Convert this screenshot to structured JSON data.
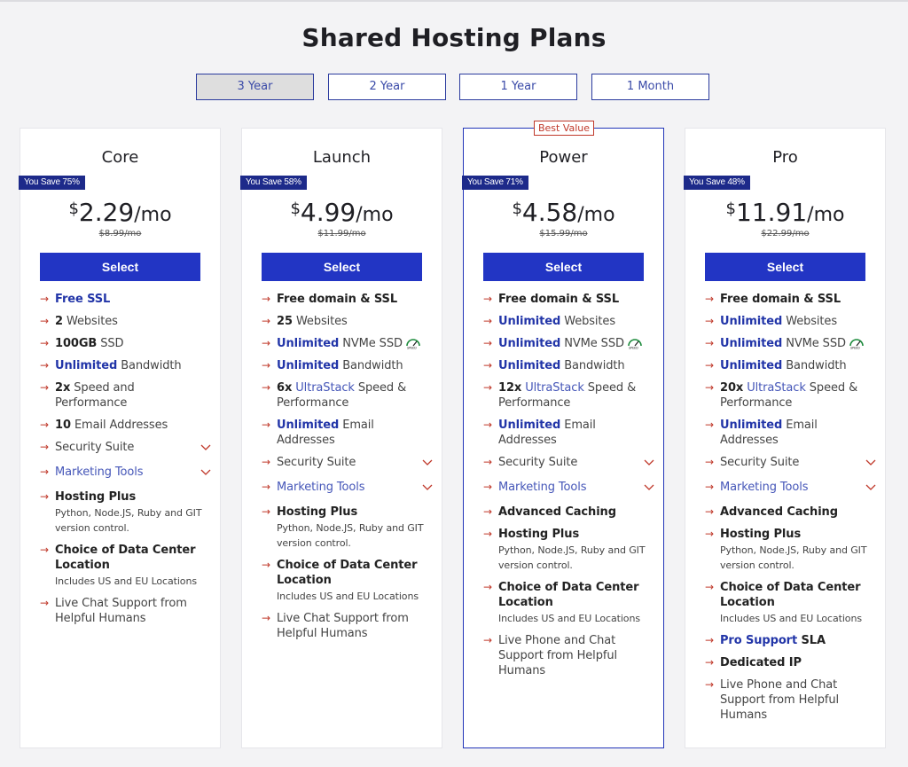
{
  "page_title": "Shared Hosting Plans",
  "terms": [
    "3 Year",
    "2 Year",
    "1 Year",
    "1 Month"
  ],
  "best_value_label": "Best Value",
  "plans": [
    {
      "name": "Core",
      "save": "You Save 75%",
      "currency": "$",
      "amount": "2.29",
      "per": "/mo",
      "old": "$8.99/mo",
      "button": "Select",
      "features": [
        {
          "hl": "Free SSL",
          "text": ""
        },
        {
          "bold": "2",
          "text": " Websites"
        },
        {
          "bold": "100GB",
          "text": " SSD"
        },
        {
          "hl": "Unlimited",
          "text": " Bandwidth"
        },
        {
          "bold": "2x",
          "text": " Speed and Performance"
        },
        {
          "bold": "10",
          "text": " Email Addresses"
        },
        {
          "text": "Security Suite",
          "expand": true
        },
        {
          "link": "Marketing Tools",
          "expand": true
        },
        {
          "bold": "Hosting Plus",
          "sub": "Python, Node.JS, Ruby and GIT version control."
        },
        {
          "bold": "Choice of Data Center Location",
          "sub": "Includes US and EU Locations"
        },
        {
          "text": "Live Chat Support from Helpful Humans"
        }
      ]
    },
    {
      "name": "Launch",
      "save": "You Save 58%",
      "currency": "$",
      "amount": "4.99",
      "per": "/mo",
      "old": "$11.99/mo",
      "button": "Select",
      "features": [
        {
          "bold": "Free domain & SSL"
        },
        {
          "bold": "25",
          "text": " Websites"
        },
        {
          "hl": "Unlimited",
          "text": " NVMe SSD",
          "speed": true
        },
        {
          "hl": "Unlimited",
          "text": " Bandwidth"
        },
        {
          "bold": "6x",
          "link": " UltraStack",
          "text": " Speed & Performance"
        },
        {
          "hl": "Unlimited",
          "text": " Email Addresses"
        },
        {
          "text": "Security Suite",
          "expand": true
        },
        {
          "link": "Marketing Tools",
          "expand": true
        },
        {
          "bold": "Hosting Plus",
          "sub": "Python, Node.JS, Ruby and GIT version control."
        },
        {
          "bold": "Choice of Data Center Location",
          "sub": "Includes US and EU Locations"
        },
        {
          "text": "Live Chat Support from Helpful Humans"
        }
      ]
    },
    {
      "name": "Power",
      "save": "You Save 71%",
      "currency": "$",
      "amount": "4.58",
      "per": "/mo",
      "old": "$15.99/mo",
      "button": "Select",
      "features": [
        {
          "bold": "Free domain & SSL"
        },
        {
          "hl": "Unlimited",
          "text": " Websites"
        },
        {
          "hl": "Unlimited",
          "text": " NVMe SSD",
          "speed": true
        },
        {
          "hl": "Unlimited",
          "text": " Bandwidth"
        },
        {
          "bold": "12x",
          "link": " UltraStack",
          "text": " Speed & Performance"
        },
        {
          "hl": "Unlimited",
          "text": " Email Addresses"
        },
        {
          "text": "Security Suite",
          "expand": true
        },
        {
          "link": "Marketing Tools",
          "expand": true
        },
        {
          "bold": "Advanced Caching"
        },
        {
          "bold": "Hosting Plus",
          "sub": "Python, Node.JS, Ruby and GIT version control."
        },
        {
          "bold": "Choice of Data Center Location",
          "sub": "Includes US and EU Locations"
        },
        {
          "text": "Live Phone and Chat Support from Helpful Humans"
        }
      ]
    },
    {
      "name": "Pro",
      "save": "You Save 48%",
      "currency": "$",
      "amount": "11.91",
      "per": "/mo",
      "old": "$22.99/mo",
      "button": "Select",
      "features": [
        {
          "bold": "Free domain & SSL"
        },
        {
          "hl": "Unlimited",
          "text": " Websites"
        },
        {
          "hl": "Unlimited",
          "text": " NVMe SSD",
          "speed": true
        },
        {
          "hl": "Unlimited",
          "text": " Bandwidth"
        },
        {
          "bold": "20x",
          "link": " UltraStack",
          "text": " Speed & Performance"
        },
        {
          "hl": "Unlimited",
          "text": " Email Addresses"
        },
        {
          "text": "Security Suite",
          "expand": true
        },
        {
          "link": "Marketing Tools",
          "expand": true
        },
        {
          "bold": "Advanced Caching"
        },
        {
          "bold": "Hosting Plus",
          "sub": "Python, Node.JS, Ruby and GIT version control."
        },
        {
          "bold": "Choice of Data Center Location",
          "sub": "Includes US and EU Locations"
        },
        {
          "hl": "Pro Support",
          "bold2": " SLA"
        },
        {
          "bold": "Dedicated IP"
        },
        {
          "text": "Live Phone and Chat Support from Helpful Humans"
        }
      ]
    }
  ],
  "colors": {
    "accent": "#2235c4",
    "badge": "#1d2a8a",
    "arrow": "#c0392b",
    "highlight": "#2235a8"
  },
  "icons": {
    "feature_bullet": "arrow-right-icon",
    "expand": "chevron-down-icon",
    "speed": "speed-badge-icon"
  }
}
